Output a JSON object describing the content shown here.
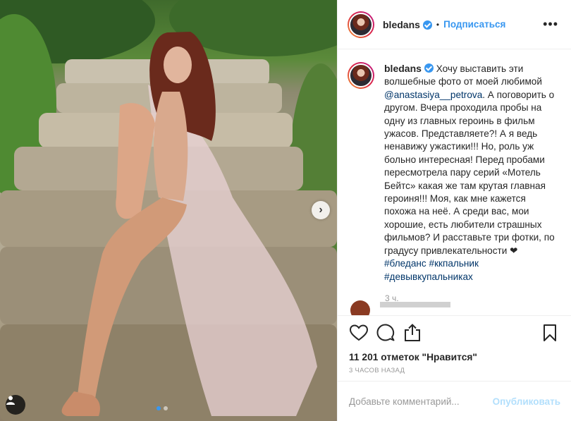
{
  "post": {
    "username": "bledans",
    "separator": "•",
    "follow_label": "Подписаться",
    "more_label": "•••",
    "caption": {
      "pre": "Хочу выставить эти волшебные фото от моей любимой ",
      "mention": "@anastasiya__petrova",
      "body": ". А поговорить о другом. Вчера проходила пробы на одну из главных героинь в фильм ужасов. Представляете?! А я ведь ненавижу ужастики!!! Но, роль уж больно интересная! Перед пробами пересмотрела пару серий «Мотель Бейтс» какая же там крутая главная героиня!!! Моя, как мне кажется похожа на неё. А среди вас, мои хорошие, есть любители страшных фильмов? И расставьте три фотки, по градусу привлекательности ❤",
      "hashtags": [
        "#бледанс",
        "#ккпальник",
        "#девывкупальниках"
      ]
    },
    "caption_time": "3 ч.",
    "likes_text": "11 201 отметок \"Нравится\"",
    "posted_ago": "3 часов назад",
    "comment_placeholder": "Добавьте комментарий...",
    "publish_label": "Опубликовать",
    "carousel": {
      "total": 2,
      "active_index": 0
    }
  },
  "colors": {
    "accent": "#3897f0",
    "publish_disabled": "#b2dffc",
    "text": "#262626",
    "muted": "#999999"
  },
  "icons": [
    "heart-icon",
    "comment-icon",
    "share-icon",
    "bookmark-icon",
    "user-tag-icon",
    "chevron-right-icon",
    "verified-badge-icon"
  ]
}
